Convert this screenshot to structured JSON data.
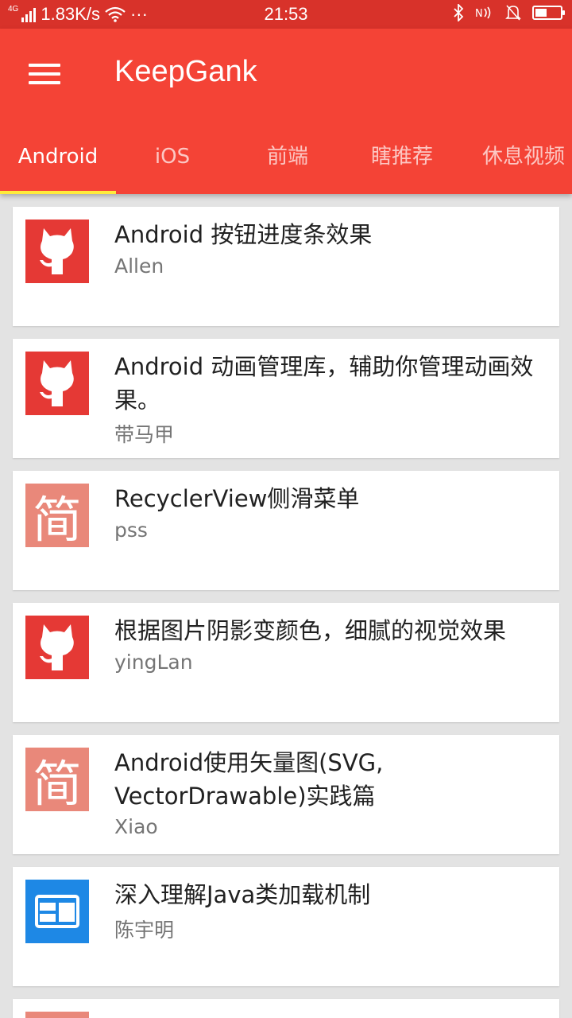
{
  "status_bar": {
    "network_type": "4G",
    "speed": "1.83K/s",
    "more": "···",
    "time": "21:53"
  },
  "app_bar": {
    "title": "KeepGank"
  },
  "tabs": [
    {
      "label": "Android",
      "active": true
    },
    {
      "label": "iOS",
      "active": false
    },
    {
      "label": "前端",
      "active": false
    },
    {
      "label": "瞎推荐",
      "active": false
    },
    {
      "label": "休息视频",
      "active": false
    }
  ],
  "colors": {
    "primary": "#f44336",
    "status_bar": "#d8322a",
    "indicator": "#ffeb3b"
  },
  "items": [
    {
      "title": "Android 按钮进度条效果",
      "author": "Allen",
      "thumb": "github-octocat-icon"
    },
    {
      "title": "Android 动画管理库，辅助你管理动画效果。",
      "author": "带马甲",
      "thumb": "github-octocat-icon"
    },
    {
      "title": "RecyclerView侧滑菜单",
      "author": "pss",
      "thumb": "jianshu-icon",
      "thumb_text": "简"
    },
    {
      "title": "根据图片阴影变颜色，细腻的视觉效果",
      "author": "yingLan",
      "thumb": "github-octocat-icon"
    },
    {
      "title": "Android使用矢量图(SVG, VectorDrawable)实践篇",
      "author": "Xiao",
      "thumb": "jianshu-icon",
      "thumb_text": "简"
    },
    {
      "title": "深入理解Java类加载机制",
      "author": "陈宇明",
      "thumb": "web-page-icon"
    }
  ]
}
